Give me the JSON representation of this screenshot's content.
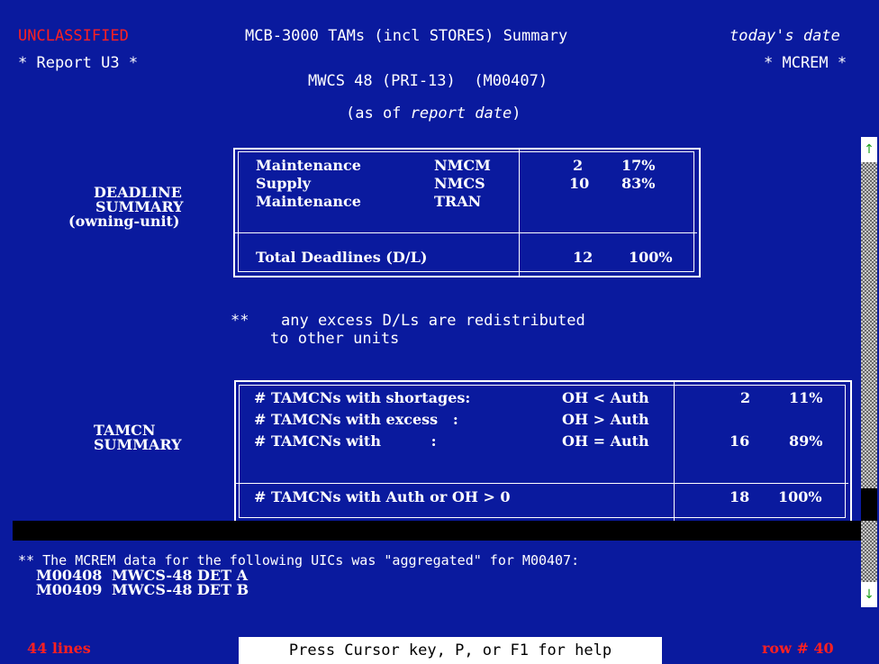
{
  "header": {
    "classification": "UNCLASSIFIED",
    "title": "MCB-3000 TAMs (incl STORES) Summary",
    "date_label": "today's date",
    "report_id": "* Report U3 *",
    "system": "* MCREM *",
    "unit": "MWCS 48 (PRI-13)  (M00407)",
    "as_of_prefix": "(as of ",
    "as_of_value": "report date",
    "as_of_suffix": ")"
  },
  "deadline": {
    "section_label_1": "DEADLINE",
    "section_label_2": "SUMMARY",
    "section_label_3": "(owning-unit)",
    "rows": [
      {
        "category": "Maintenance",
        "code": "NMCM",
        "count": "2",
        "pct": "17%"
      },
      {
        "category": "Supply",
        "code": "NMCS",
        "count": "10",
        "pct": "83%"
      },
      {
        "category": "Maintenance",
        "code": "TRAN",
        "count": "",
        "pct": ""
      }
    ],
    "total_label": "Total Deadlines (D/L)",
    "total_count": "12",
    "total_pct": "100%"
  },
  "note": {
    "marker": "**",
    "line1": "any excess D/Ls are redistributed",
    "line2": "to other units"
  },
  "tamcn": {
    "section_label_1": "TAMCN",
    "section_label_2": "SUMMARY",
    "rows": [
      {
        "label": "# TAMCNs with shortages:",
        "condition": "OH < Auth",
        "count": "2",
        "pct": "11%"
      },
      {
        "label": "# TAMCNs with excess   :",
        "condition": "OH > Auth",
        "count": "",
        "pct": ""
      },
      {
        "label": "# TAMCNs with          :",
        "condition": "OH = Auth",
        "count": "16",
        "pct": "89%"
      }
    ],
    "total_label": "# TAMCNs with Auth or OH > 0",
    "total_count": "18",
    "total_pct": "100%"
  },
  "aggregate": {
    "line": "** The MCREM data for the following UICs was \"aggregated\" for M00407:",
    "uics": [
      {
        "uic": "M00408",
        "name": "MWCS-48 DET A"
      },
      {
        "uic": "M00409",
        "name": "MWCS-48 DET B"
      }
    ]
  },
  "footer": {
    "lines": "44 lines",
    "help": "Press Cursor key, P, or F1 for help",
    "row": "row # 40"
  },
  "colors": {
    "background": "#0a1a9e",
    "accent_red": "#ff2020",
    "text": "#ffffff"
  },
  "icons": {
    "scroll_up": "arrow-up-icon",
    "scroll_down": "arrow-down-icon"
  }
}
